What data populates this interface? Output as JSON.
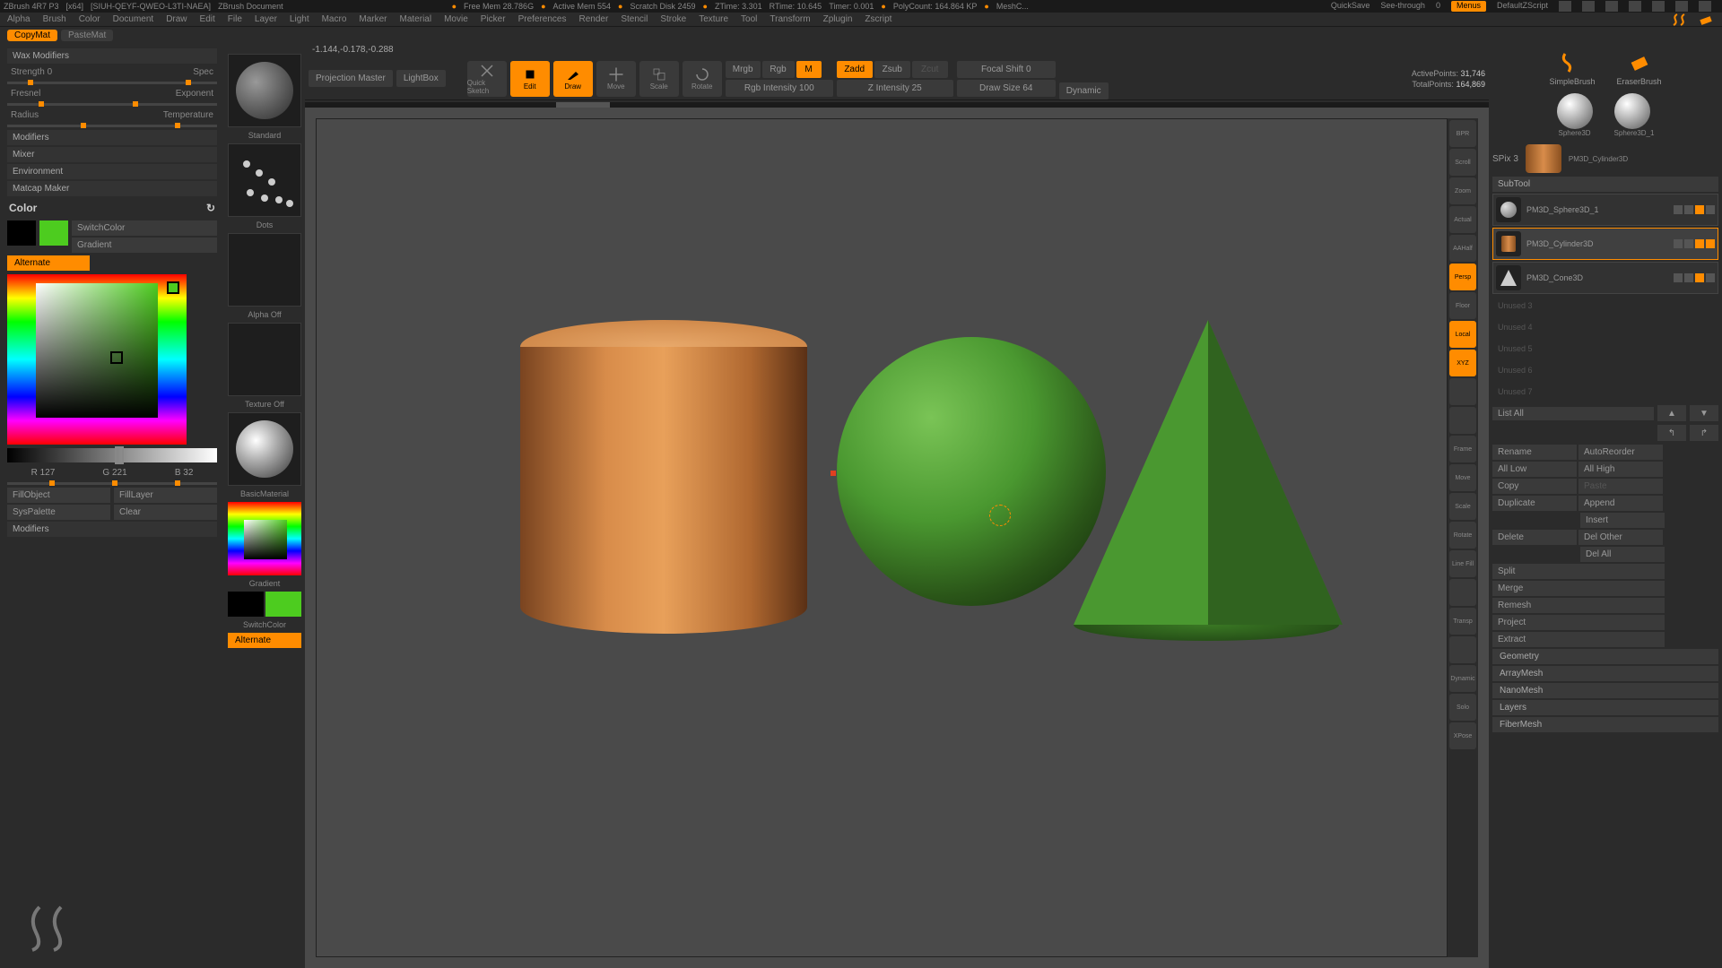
{
  "titlebar": {
    "app": "ZBrush 4R7 P3",
    "arch": "[x64]",
    "doc": "[SIUH-QEYF-QWEO-L3TI-NAEA]",
    "docname": "ZBrush Document",
    "freemem": "Free Mem 28.786G",
    "activemem": "Active Mem 554",
    "scratch": "Scratch Disk 2459",
    "ztime": "ZTime: 3.301",
    "rtime": "RTime: 10.645",
    "timer": "Timer: 0.001",
    "polycount": "PolyCount: 164.864 KP",
    "meshc": "MeshC...",
    "quicksave": "QuickSave",
    "seethrough": "See-through",
    "seethrough_val": "0",
    "menus": "Menus",
    "script": "DefaultZScript"
  },
  "menubar": [
    "Alpha",
    "Brush",
    "Color",
    "Document",
    "Draw",
    "Edit",
    "File",
    "Layer",
    "Light",
    "Macro",
    "Marker",
    "Material",
    "Movie",
    "Picker",
    "Preferences",
    "Render",
    "Stencil",
    "Stroke",
    "Texture",
    "Tool",
    "Transform",
    "Zplugin",
    "Zscript"
  ],
  "top_buttons": {
    "copymat": "CopyMat",
    "pastemat": "PasteMat"
  },
  "left": {
    "wax_hdr": "Wax Modifiers",
    "strength": "Strength 0",
    "spec": "Spec",
    "fresnel": "Fresnel",
    "exponent": "Exponent",
    "radius": "Radius",
    "temperature": "Temperature",
    "modifiers": "Modifiers",
    "mixer": "Mixer",
    "environment": "Environment",
    "matcap": "Matcap Maker",
    "color_hdr": "Color",
    "switch": "SwitchColor",
    "gradient": "Gradient",
    "alternate": "Alternate",
    "r": "R 127",
    "g": "G 221",
    "b": "B 32",
    "fillobj": "FillObject",
    "filllayer": "FillLayer",
    "syspal": "SysPalette",
    "clear": "Clear",
    "modifiers2": "Modifiers"
  },
  "toolcol": {
    "standard": "Standard",
    "dots": "Dots",
    "alpha_off": "Alpha Off",
    "texture_off": "Texture Off",
    "basicmat": "BasicMaterial",
    "gradient": "Gradient",
    "switch": "SwitchColor",
    "alternate": "Alternate"
  },
  "coords": "-1.144,-0.178,-0.288",
  "controls": {
    "projection": "Projection Master",
    "lightbox": "LightBox",
    "quick": "Quick Sketch",
    "edit": "Edit",
    "draw": "Draw",
    "move": "Move",
    "scale": "Scale",
    "rotate": "Rotate",
    "mrgb": "Mrgb",
    "rgb": "Rgb",
    "m": "M",
    "rgbint": "Rgb Intensity 100",
    "zadd": "Zadd",
    "zsub": "Zsub",
    "zcut": "Zcut",
    "zint": "Z Intensity 25",
    "focal": "Focal Shift 0",
    "drawsize": "Draw Size 64",
    "dynamic": "Dynamic",
    "active": "ActivePoints:",
    "active_val": "31,746",
    "total": "TotalPoints:",
    "total_val": "164,869"
  },
  "sidetools": [
    "BPR",
    "Scroll",
    "Zoom",
    "Actual",
    "AAHalf",
    "Persp",
    "Floor",
    "Local",
    "XYZ",
    "",
    "",
    "Frame",
    "Move",
    "Scale",
    "Rotate",
    "Line Fill",
    "",
    "Transp",
    "",
    "Dynamic",
    "Solo",
    "XPose"
  ],
  "sidetools_active": [
    5,
    7,
    8
  ],
  "right": {
    "simple": "SimpleBrush",
    "eraser": "EraserBrush",
    "sphere3d": "Sphere3D",
    "sphere3d1": "Sphere3D_1",
    "spix": "SPix 3",
    "cyl": "PM3D_Cylinder3D",
    "subtool_hdr": "SubTool",
    "items": [
      {
        "name": "PM3D_Sphere3D_1"
      },
      {
        "name": "PM3D_Cylinder3D"
      },
      {
        "name": "PM3D_Cone3D"
      }
    ],
    "empty": [
      "Unused 3",
      "Unused 4",
      "Unused 5",
      "Unused 6",
      "Unused 7"
    ],
    "listall": "List All",
    "actions": {
      "rename": "Rename",
      "autoreorder": "AutoReorder",
      "alllow": "All Low",
      "allhigh": "All High",
      "copy": "Copy",
      "paste": "Paste",
      "duplicate": "Duplicate",
      "append": "Append",
      "insert": "Insert",
      "delete": "Delete",
      "delother": "Del Other",
      "delall": "Del All",
      "split": "Split",
      "merge": "Merge",
      "remesh": "Remesh",
      "project": "Project",
      "extract": "Extract"
    },
    "sections": [
      "Geometry",
      "ArrayMesh",
      "NanoMesh",
      "Layers",
      "FiberMesh"
    ]
  }
}
